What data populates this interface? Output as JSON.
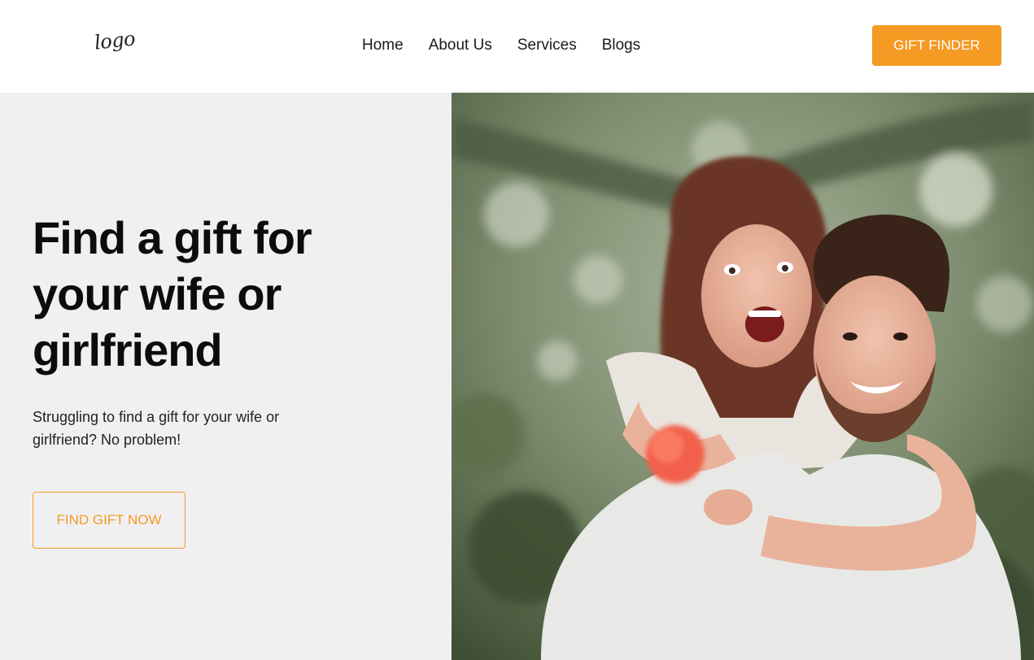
{
  "header": {
    "logo_text": "logo",
    "nav": [
      {
        "label": "Home"
      },
      {
        "label": "About Us"
      },
      {
        "label": "Services"
      },
      {
        "label": "Blogs"
      }
    ],
    "cta_label": "GIFT FINDER"
  },
  "hero": {
    "title": "Find a gift for your wife or girlfriend",
    "subtitle": "Struggling to find a gift for your wife or girlfriend? No problem!",
    "button_label": "FIND GIFT NOW",
    "image": "photo-couple-piggyback"
  },
  "colors": {
    "accent": "#f59a23",
    "hero_bg": "#f0f0f2",
    "header_bg": "#ffffff",
    "text": "#111111"
  }
}
